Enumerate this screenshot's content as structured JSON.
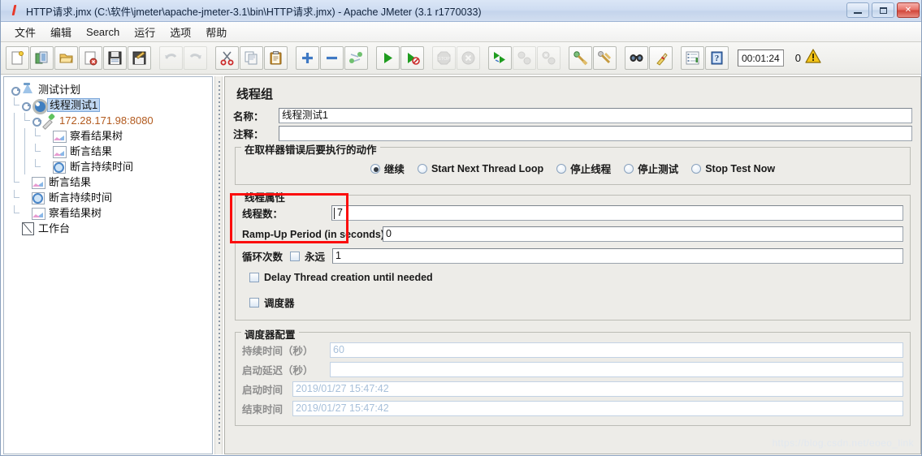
{
  "window": {
    "title": "HTTP请求.jmx (C:\\软件\\jmeter\\apache-jmeter-3.1\\bin\\HTTP请求.jmx) - Apache JMeter (3.1 r1770033)",
    "icon": "jmeter-feather-icon",
    "minimize_label": "_",
    "maximize_label": "□",
    "close_label": "✕"
  },
  "menubar": {
    "items": [
      {
        "label": "文件",
        "name": "menu-file"
      },
      {
        "label": "编辑",
        "name": "menu-edit"
      },
      {
        "label": "Search",
        "name": "menu-search"
      },
      {
        "label": "运行",
        "name": "menu-run"
      },
      {
        "label": "选项",
        "name": "menu-options"
      },
      {
        "label": "帮助",
        "name": "menu-help"
      }
    ]
  },
  "toolbar": {
    "buttons": [
      {
        "name": "new-icon",
        "enabled": true
      },
      {
        "name": "templates-icon",
        "enabled": true
      },
      {
        "name": "open-icon",
        "enabled": true
      },
      {
        "name": "close-icon",
        "enabled": true
      },
      {
        "name": "save-icon",
        "enabled": true
      },
      {
        "name": "save-as-icon",
        "enabled": true
      },
      {
        "name": "undo-icon",
        "enabled": false
      },
      {
        "name": "redo-icon",
        "enabled": false
      },
      {
        "name": "cut-icon",
        "enabled": true
      },
      {
        "name": "copy-icon",
        "enabled": true
      },
      {
        "name": "paste-icon",
        "enabled": true
      },
      {
        "name": "expand-all-icon",
        "enabled": true
      },
      {
        "name": "collapse-all-icon",
        "enabled": true
      },
      {
        "name": "toggle-icon",
        "enabled": true
      },
      {
        "name": "start-icon",
        "enabled": true
      },
      {
        "name": "start-no-pauses-icon",
        "enabled": true
      },
      {
        "name": "stop-icon",
        "enabled": false
      },
      {
        "name": "shutdown-icon",
        "enabled": false
      },
      {
        "name": "remote-start-all-icon",
        "enabled": true
      },
      {
        "name": "remote-stop-all-icon",
        "enabled": false
      },
      {
        "name": "remote-shutdown-all-icon",
        "enabled": false
      },
      {
        "name": "clear-icon",
        "enabled": true
      },
      {
        "name": "clear-all-icon",
        "enabled": true
      },
      {
        "name": "search-icon",
        "enabled": true
      },
      {
        "name": "reset-search-icon",
        "enabled": true
      },
      {
        "name": "function-helper-icon",
        "enabled": true
      },
      {
        "name": "help-icon",
        "enabled": true
      }
    ],
    "timer": "00:01:24",
    "error_count": "0",
    "warning_icon": "warning-triangle-icon"
  },
  "tree": {
    "nodes": [
      {
        "label": "测试计划",
        "icon": "test-plan-icon",
        "depth": 0,
        "selected": false,
        "kind": "testplan"
      },
      {
        "label": "线程测试1",
        "icon": "thread-group-icon",
        "depth": 1,
        "selected": true,
        "kind": "threadgroup"
      },
      {
        "label": "172.28.171.98:8080",
        "icon": "http-sampler-icon",
        "depth": 2,
        "selected": false,
        "kind": "sampler"
      },
      {
        "label": "察看结果树",
        "icon": "view-results-tree-icon",
        "depth": 3,
        "selected": false,
        "kind": "listener"
      },
      {
        "label": "断言结果",
        "icon": "assertion-results-icon",
        "depth": 3,
        "selected": false,
        "kind": "listener"
      },
      {
        "label": "断言持续时间",
        "icon": "duration-assertion-icon",
        "depth": 3,
        "selected": false,
        "kind": "timer"
      },
      {
        "label": "断言结果",
        "icon": "assertion-results-icon",
        "depth": 1,
        "selected": false,
        "kind": "listener"
      },
      {
        "label": "断言持续时间",
        "icon": "duration-assertion-icon",
        "depth": 1,
        "selected": false,
        "kind": "timer"
      },
      {
        "label": "察看结果树",
        "icon": "view-results-tree-icon",
        "depth": 1,
        "selected": false,
        "kind": "listener"
      },
      {
        "label": "工作台",
        "icon": "workbench-icon",
        "depth": 0,
        "selected": false,
        "kind": "workbench"
      }
    ]
  },
  "panel": {
    "title": "线程组",
    "name_label": "名称：",
    "name_value": "线程测试1",
    "comment_label": "注释：",
    "comment_value": "",
    "on_error": {
      "group_title": "在取样器错误后要执行的动作",
      "options": [
        {
          "label": "继续",
          "selected": true
        },
        {
          "label": "Start Next Thread Loop",
          "selected": false
        },
        {
          "label": "停止线程",
          "selected": false
        },
        {
          "label": "停止测试",
          "selected": false
        },
        {
          "label": "Stop Test Now",
          "selected": false
        }
      ]
    },
    "thread_props": {
      "group_title": "线程属性",
      "threads_label": "线程数：",
      "threads_value": "7",
      "rampup_label": "Ramp-Up Period (in seconds):",
      "rampup_value": "0",
      "loop_label": "循环次数",
      "forever_label": "永远",
      "forever_checked": false,
      "loop_value": "1",
      "delay_creation_label": "Delay Thread creation until needed",
      "delay_creation_checked": false,
      "scheduler_label": "调度器",
      "scheduler_checked": false
    },
    "scheduler": {
      "group_title": "调度器配置",
      "duration_label": "持续时间（秒）",
      "duration_value": "60",
      "startup_delay_label": "启动延迟（秒）",
      "startup_delay_value": "",
      "start_time_label": "启动时间",
      "start_time_value": "2019/01/27 15:47:42",
      "end_time_label": "结束时间",
      "end_time_value": "2019/01/27 15:47:42"
    }
  },
  "annotation": {
    "highlight_color": "#fb0d0d",
    "highlight_target": "线程数"
  },
  "watermark": "https://blog.csdn.net/eoeo_link"
}
